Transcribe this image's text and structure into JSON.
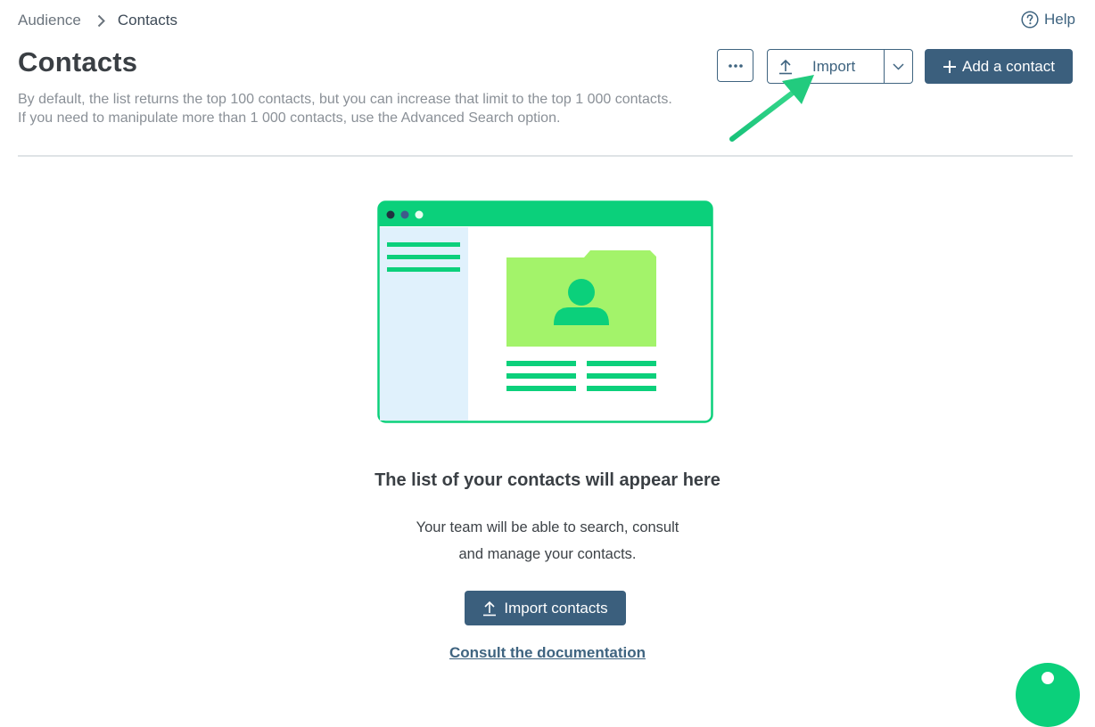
{
  "breadcrumb": {
    "parent": "Audience",
    "current": "Contacts"
  },
  "help": {
    "label": "Help",
    "icon": "question-circle-icon"
  },
  "header": {
    "title": "Contacts",
    "description": "By default, the list returns the top 100 contacts, but you can increase that limit to the top 1 000 contacts. If you need to manipulate more than 1 000 contacts, use the Advanced Search option."
  },
  "toolbar": {
    "more_icon": "more-dots-icon",
    "import_label": "Import",
    "import_icon": "upload-icon",
    "import_dropdown_icon": "chevron-down-icon",
    "add_contact_label": "Add a contact",
    "add_contact_icon": "plus-icon"
  },
  "empty_state": {
    "title": "The list of your contacts will appear here",
    "text_line1": "Your team will be able to search, consult",
    "text_line2": "and manage your contacts.",
    "import_button_label": "Import contacts",
    "doc_link": "Consult the documentation"
  },
  "colors": {
    "primary": "#3b5f7d",
    "accent_green": "#0bd07b",
    "light_green": "#a3f36a",
    "light_blue": "#e0f1fc"
  }
}
